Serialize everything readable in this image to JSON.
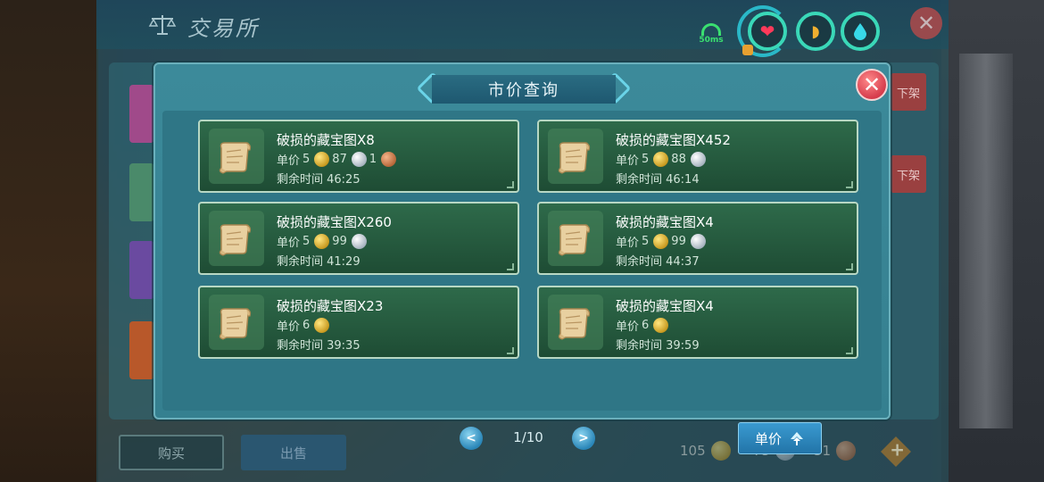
{
  "background": {
    "title": "交易所",
    "remove_labels": [
      "下架",
      "下架"
    ],
    "buy_label": "购买",
    "sell_label": "出售",
    "currency": [
      {
        "amount": "105",
        "type": "gold"
      },
      {
        "amount": "75",
        "type": "silver"
      },
      {
        "amount": "51",
        "type": "copper"
      }
    ],
    "add_icon": "plus-diamond-icon"
  },
  "hud": {
    "ping": "50ms",
    "status_icons": [
      "heart-icon",
      "stomach-icon",
      "water-drop-icon"
    ],
    "close_label": "✕"
  },
  "modal": {
    "title": "市价查询",
    "close_label": "✕",
    "price_label": "单价",
    "time_label": "剩余时间",
    "listings": [
      {
        "name": "破损的藏宝图X8",
        "gold": "5",
        "silver": "87",
        "copper": "1",
        "time": "46:25"
      },
      {
        "name": "破损的藏宝图X452",
        "gold": "5",
        "silver": "88",
        "copper": "",
        "time": "46:14"
      },
      {
        "name": "破损的藏宝图X260",
        "gold": "5",
        "silver": "99",
        "copper": "",
        "time": "41:29"
      },
      {
        "name": "破损的藏宝图X4",
        "gold": "5",
        "silver": "99",
        "copper": "",
        "time": "44:37"
      },
      {
        "name": "破损的藏宝图X23",
        "gold": "6",
        "silver": "",
        "copper": "",
        "time": "39:35"
      },
      {
        "name": "破损的藏宝图X4",
        "gold": "6",
        "silver": "",
        "copper": "",
        "time": "39:59"
      }
    ],
    "pagination": {
      "current": 1,
      "total": 10,
      "text": "1/10"
    },
    "prev_label": "<",
    "next_label": ">",
    "sort_label": "单价",
    "sort_icon": "sort-up-icon"
  }
}
